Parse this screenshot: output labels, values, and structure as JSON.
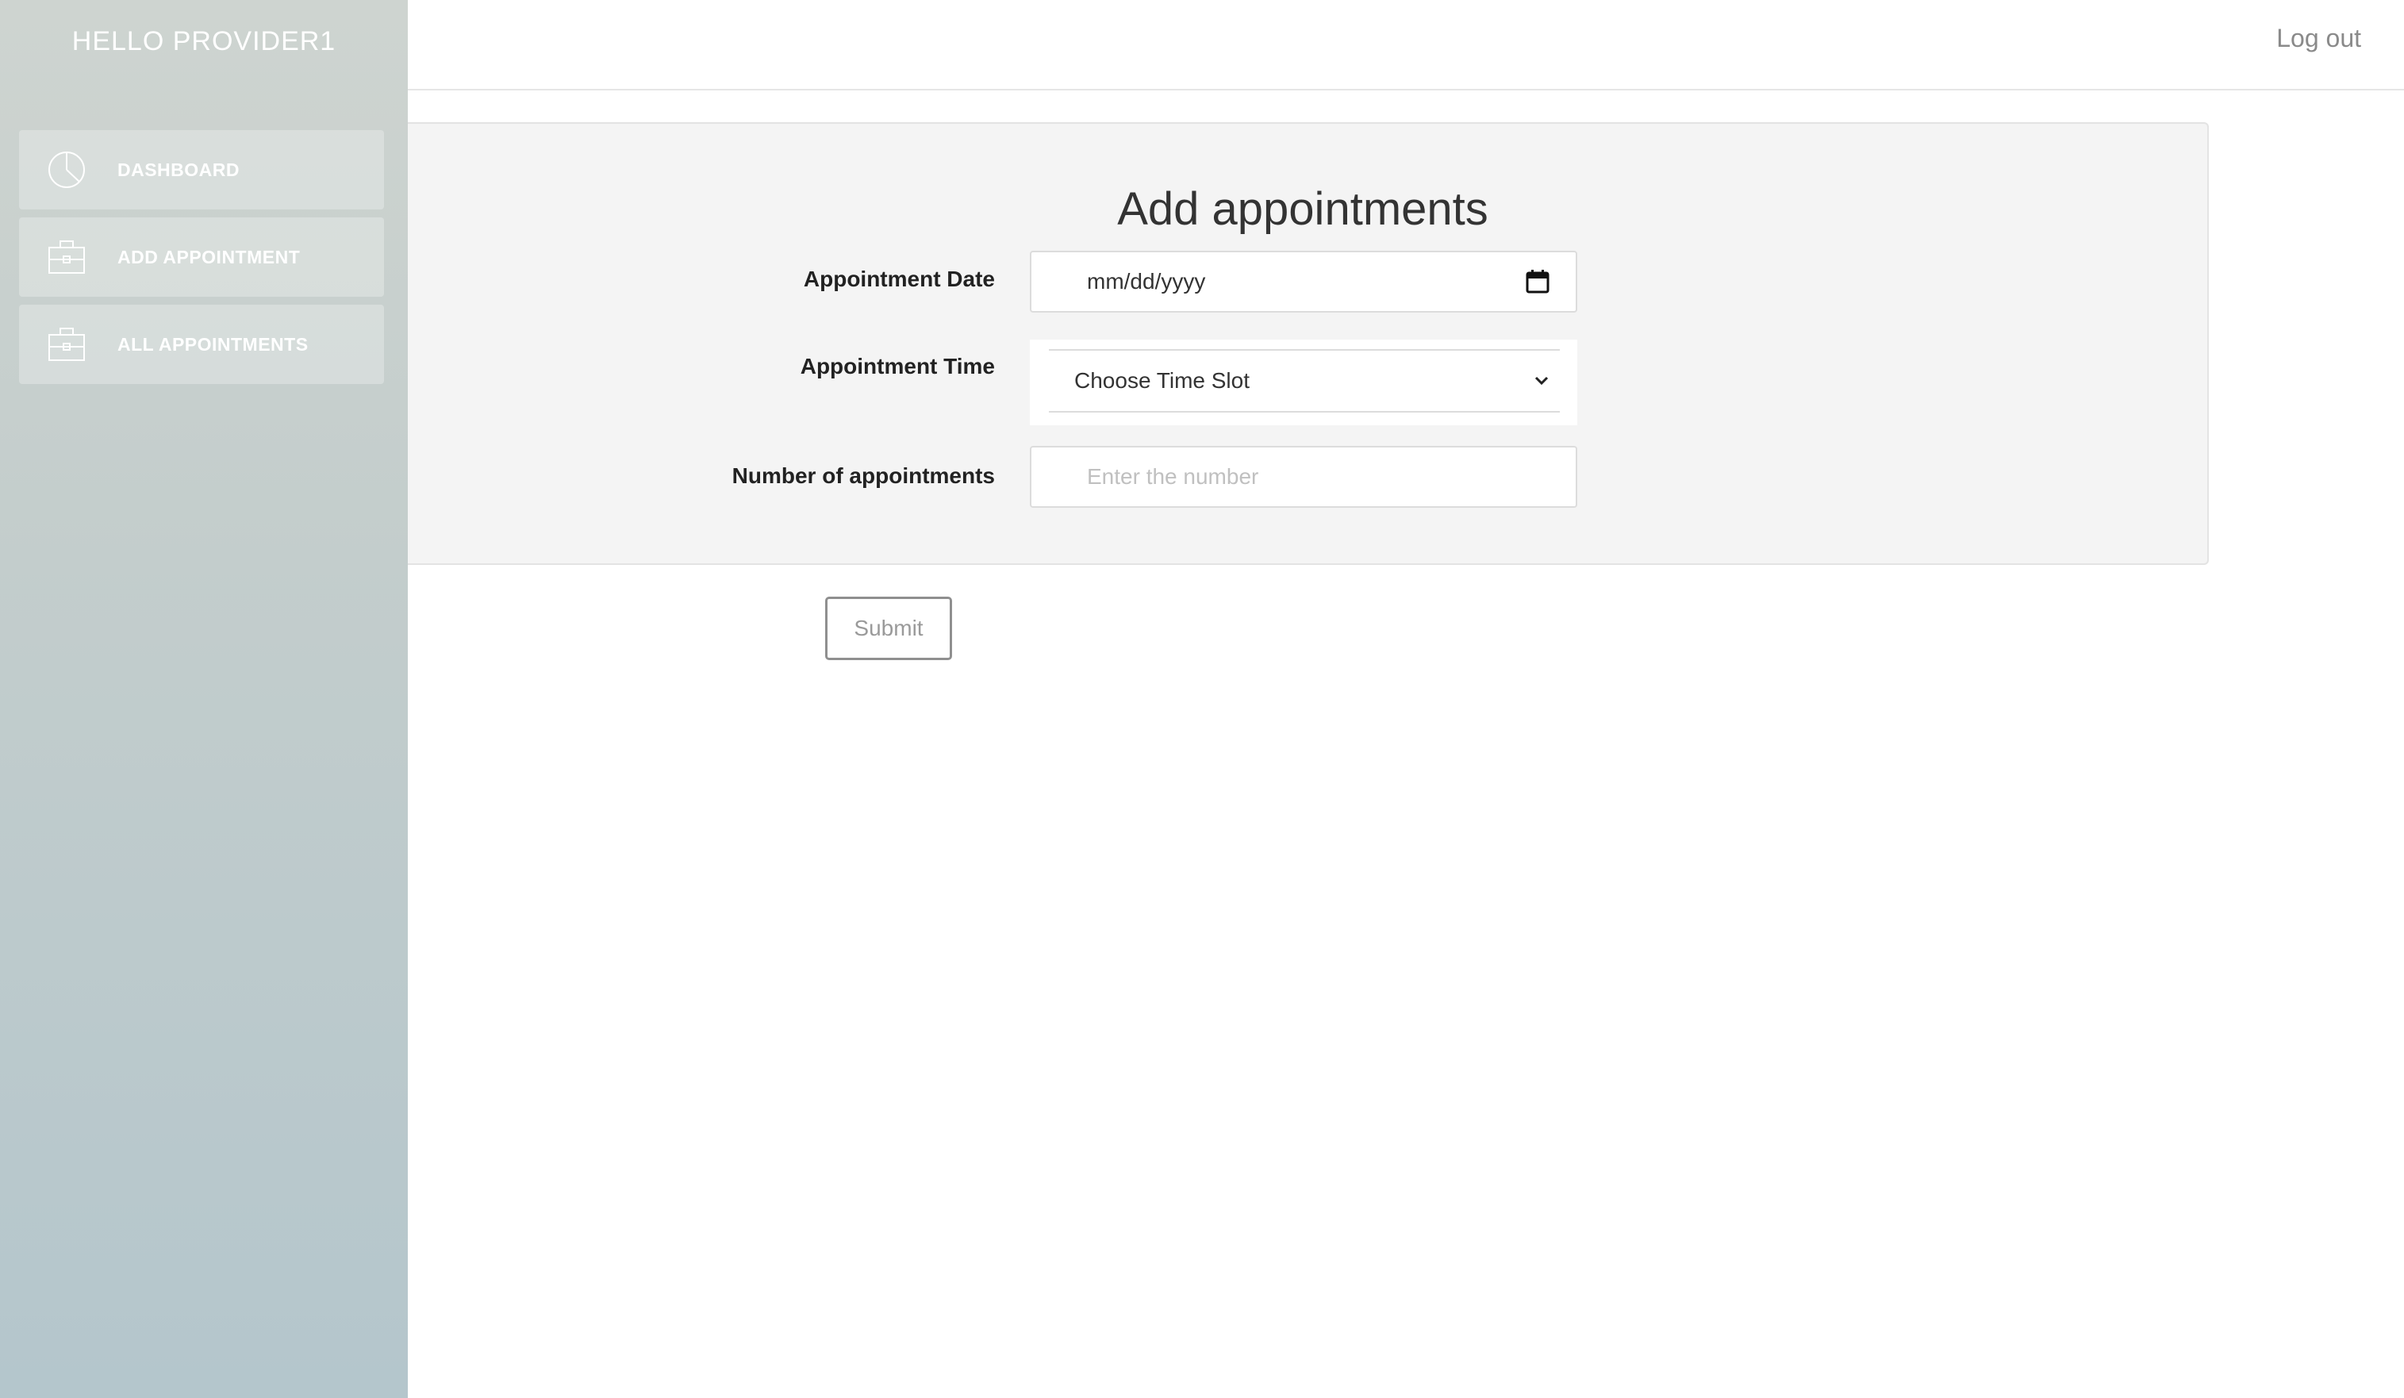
{
  "sidebar": {
    "greeting": "HELLO PROVIDER1",
    "items": [
      {
        "label": "DASHBOARD",
        "icon": "pie-chart-icon"
      },
      {
        "label": "ADD APPOINTMENT",
        "icon": "briefcase-icon"
      },
      {
        "label": "ALL APPOINTMENTS",
        "icon": "briefcase-icon"
      }
    ]
  },
  "topbar": {
    "logout_label": "Log out"
  },
  "form": {
    "title": "Add appointments",
    "date_label": "Appointment Date",
    "date_value": "mm/dd/yyyy",
    "time_label": "Appointment Time",
    "time_value": "Choose Time Slot",
    "count_label": "Number of appointments",
    "count_placeholder": "Enter the number",
    "submit_label": "Submit"
  },
  "colors": {
    "sidebar_top": "#ced4d0",
    "sidebar_bottom": "#b4c6cc",
    "card_bg": "#f4f4f4"
  }
}
